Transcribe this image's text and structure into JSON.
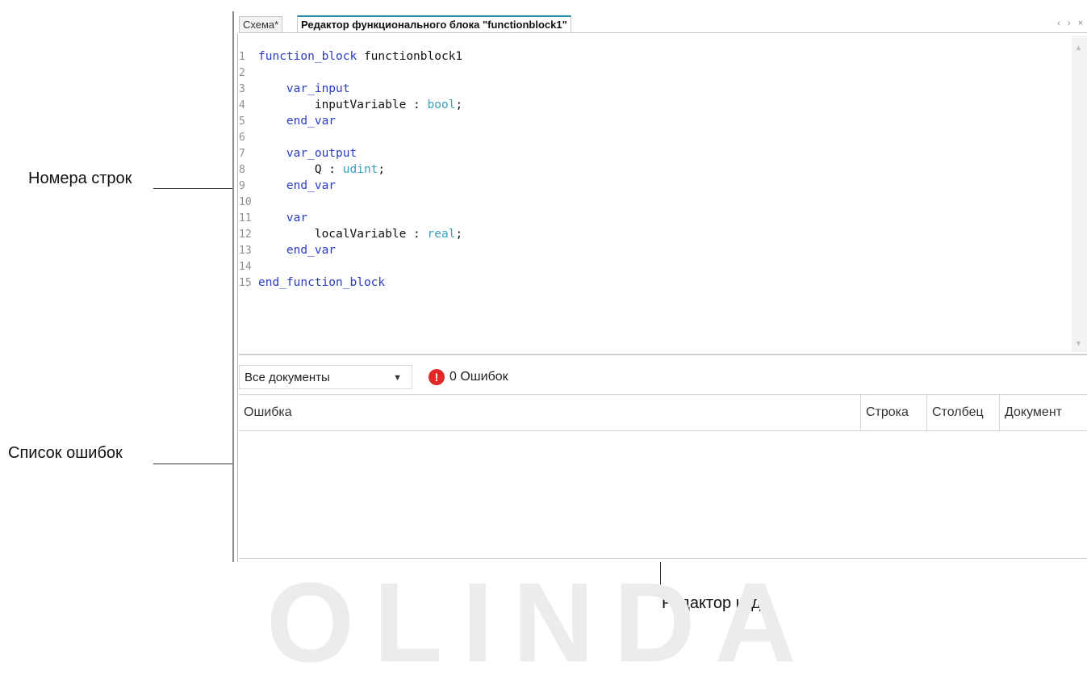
{
  "labels": {
    "line_numbers": "Номера строк",
    "error_list": "Список ошибок",
    "code_editor": "Редактор кода"
  },
  "tabs": [
    {
      "label": "Схема*",
      "active": false
    },
    {
      "label": "Редактор функционального блока \"functionblock1\"",
      "active": true
    }
  ],
  "tab_nav": "‹ › ×",
  "code": {
    "numbers": [
      "1",
      "2",
      "3",
      "4",
      "5",
      "6",
      "7",
      "8",
      "9",
      "10",
      "11",
      "12",
      "13",
      "14",
      "15"
    ],
    "lines": [
      {
        "kw": "function_block",
        "text": " functionblock1",
        "type": "",
        "end": ""
      },
      {
        "kw": "",
        "text": "",
        "type": "",
        "end": ""
      },
      {
        "kw": "    var_input",
        "text": "",
        "type": "",
        "end": ""
      },
      {
        "kw": "",
        "text": "        inputVariable : ",
        "type": "bool",
        "end": ";"
      },
      {
        "kw": "    end_var",
        "text": "",
        "type": "",
        "end": ""
      },
      {
        "kw": "",
        "text": "",
        "type": "",
        "end": ""
      },
      {
        "kw": "    var_output",
        "text": "",
        "type": "",
        "end": ""
      },
      {
        "kw": "",
        "text": "        Q : ",
        "type": "udint",
        "end": ";"
      },
      {
        "kw": "    end_var",
        "text": "",
        "type": "",
        "end": ""
      },
      {
        "kw": "",
        "text": "",
        "type": "",
        "end": ""
      },
      {
        "kw": "    var",
        "text": "",
        "type": "",
        "end": ""
      },
      {
        "kw": "",
        "text": "        localVariable : ",
        "type": "real",
        "end": ";"
      },
      {
        "kw": "    end_var",
        "text": "",
        "type": "",
        "end": ""
      },
      {
        "kw": "",
        "text": "",
        "type": "",
        "end": ""
      },
      {
        "kw": "end_function_block",
        "text": "",
        "type": "",
        "end": ""
      }
    ]
  },
  "error_panel": {
    "document_filter": "Все документы",
    "error_count": "0 Ошибок",
    "columns": [
      "Ошибка",
      "Строка",
      "Столбец",
      "Документ"
    ]
  },
  "colors": {
    "keyword": "#2a3cc2",
    "type": "#3a9fbf",
    "active_tab_accent": "#2a8fa8",
    "error_icon": "#e02a2a"
  }
}
